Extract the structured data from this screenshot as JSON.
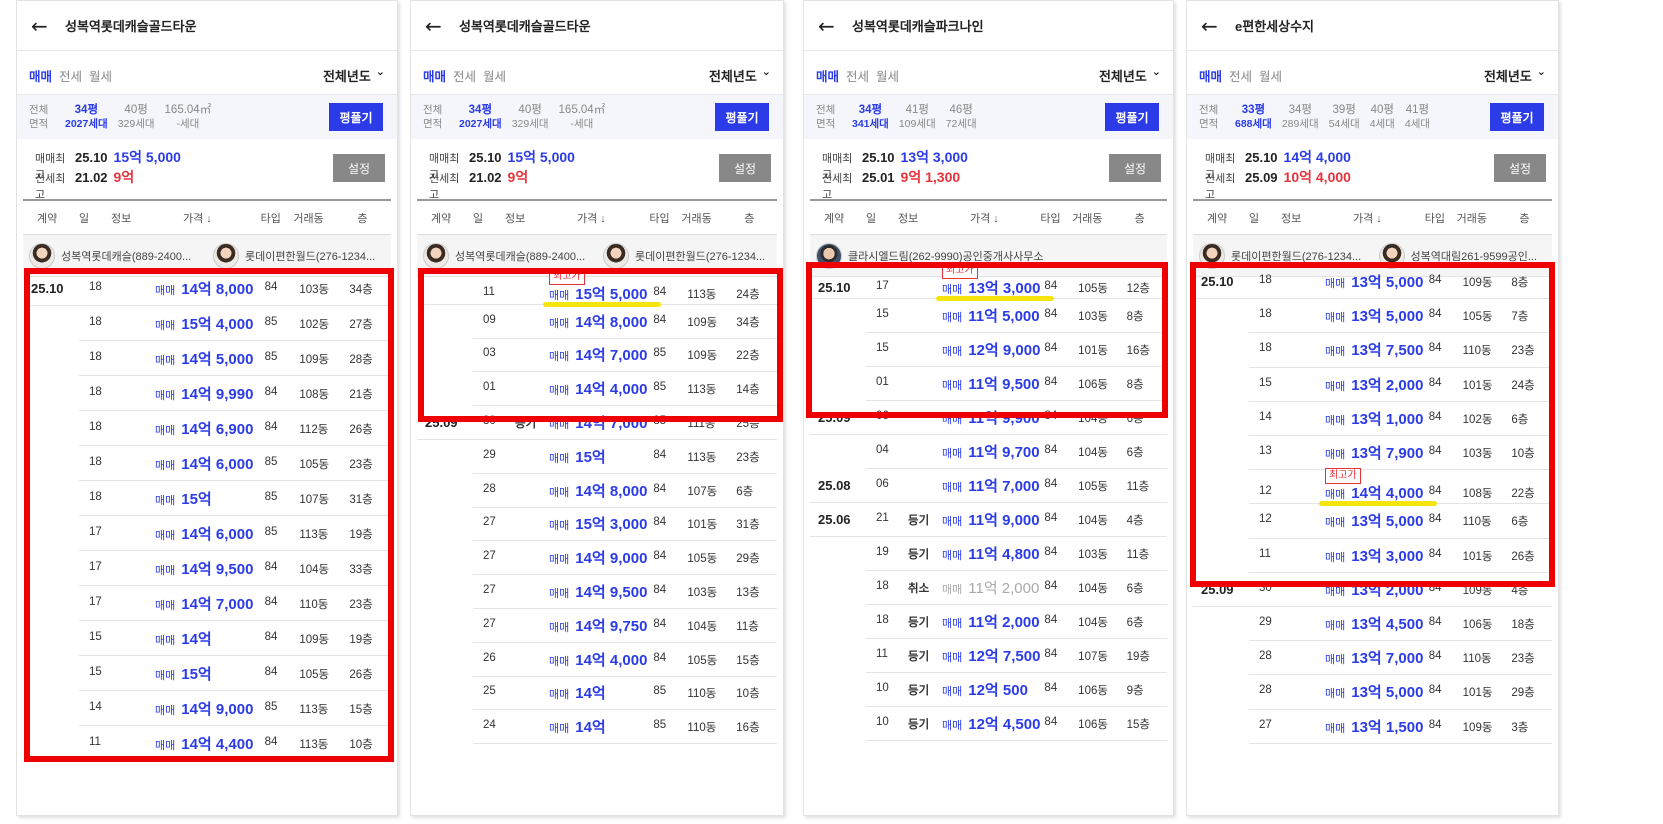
{
  "panels": [
    {
      "title": "성복역롯데캐슬골드타운",
      "tabs": [
        "매매",
        "전세",
        "월세"
      ],
      "year_filter": "전체년도",
      "area": {
        "labels": [
          "전체",
          "면적"
        ],
        "cols": [
          {
            "py": "34평",
            "hh": "2027세대",
            "selected": true
          },
          {
            "py": "40평",
            "hh": "329세대",
            "selected": false
          },
          {
            "py": "165.04㎡",
            "hh": "-세대",
            "selected": false
          }
        ],
        "button": "평풀기"
      },
      "max": {
        "sale_label": "매매최고",
        "sale_date": "25.10",
        "sale_price": "15억 5,000",
        "jeonse_label": "전세최고",
        "jeonse_date": "21.02",
        "jeonse_price": "9억"
      },
      "setting_button": "설정",
      "headers": [
        "계약",
        "일",
        "정보",
        "가격 ↓",
        "타입",
        "거래동",
        "층"
      ],
      "agents": [
        {
          "name": "성복역롯데캐슬(889-2400...",
          "avatar": "female"
        },
        {
          "name": "롯데이편한월드(276-1234...",
          "avatar": "female"
        }
      ],
      "rows": [
        {
          "date": "25.10",
          "day": "18",
          "info": "",
          "trade": "매매",
          "price": "14억 8,000",
          "type": "84",
          "dong": "103동",
          "floor": "34층"
        },
        {
          "date": "",
          "day": "18",
          "info": "",
          "trade": "매매",
          "price": "15억 4,000",
          "type": "85",
          "dong": "102동",
          "floor": "27층"
        },
        {
          "date": "",
          "day": "18",
          "info": "",
          "trade": "매매",
          "price": "14억 5,000",
          "type": "85",
          "dong": "109동",
          "floor": "28층"
        },
        {
          "date": "",
          "day": "18",
          "info": "",
          "trade": "매매",
          "price": "14억 9,990",
          "type": "84",
          "dong": "108동",
          "floor": "21층"
        },
        {
          "date": "",
          "day": "18",
          "info": "",
          "trade": "매매",
          "price": "14억 6,900",
          "type": "84",
          "dong": "112동",
          "floor": "26층"
        },
        {
          "date": "",
          "day": "18",
          "info": "",
          "trade": "매매",
          "price": "14억 6,000",
          "type": "85",
          "dong": "105동",
          "floor": "23층"
        },
        {
          "date": "",
          "day": "18",
          "info": "",
          "trade": "매매",
          "price": "15억",
          "type": "85",
          "dong": "107동",
          "floor": "31층"
        },
        {
          "date": "",
          "day": "17",
          "info": "",
          "trade": "매매",
          "price": "14억 6,000",
          "type": "85",
          "dong": "113동",
          "floor": "19층"
        },
        {
          "date": "",
          "day": "17",
          "info": "",
          "trade": "매매",
          "price": "14억 9,500",
          "type": "84",
          "dong": "104동",
          "floor": "33층"
        },
        {
          "date": "",
          "day": "17",
          "info": "",
          "trade": "매매",
          "price": "14억 7,000",
          "type": "84",
          "dong": "110동",
          "floor": "23층"
        },
        {
          "date": "",
          "day": "15",
          "info": "",
          "trade": "매매",
          "price": "14억",
          "type": "84",
          "dong": "109동",
          "floor": "19층"
        },
        {
          "date": "",
          "day": "15",
          "info": "",
          "trade": "매매",
          "price": "15억",
          "type": "84",
          "dong": "105동",
          "floor": "26층"
        },
        {
          "date": "",
          "day": "14",
          "info": "",
          "trade": "매매",
          "price": "14억 9,000",
          "type": "85",
          "dong": "113동",
          "floor": "15층"
        },
        {
          "date": "",
          "day": "11",
          "info": "",
          "trade": "매매",
          "price": "14억 4,400",
          "type": "84",
          "dong": "113동",
          "floor": "10층"
        }
      ]
    },
    {
      "title": "성복역롯데캐슬골드타운",
      "tabs": [
        "매매",
        "전세",
        "월세"
      ],
      "year_filter": "전체년도",
      "area": {
        "labels": [
          "전체",
          "면적"
        ],
        "cols": [
          {
            "py": "34평",
            "hh": "2027세대",
            "selected": true
          },
          {
            "py": "40평",
            "hh": "329세대",
            "selected": false
          },
          {
            "py": "165.04㎡",
            "hh": "-세대",
            "selected": false
          }
        ],
        "button": "평풀기"
      },
      "max": {
        "sale_label": "매매최고",
        "sale_date": "25.10",
        "sale_price": "15억 5,000",
        "jeonse_label": "전세최고",
        "jeonse_date": "21.02",
        "jeonse_price": "9억"
      },
      "setting_button": "설정",
      "headers": [
        "계약",
        "일",
        "정보",
        "가격 ↓",
        "타입",
        "거래동",
        "층"
      ],
      "agents": [
        {
          "name": "성복역롯데캐슬(889-2400...",
          "avatar": "female"
        },
        {
          "name": "롯데이편한월드(276-1234...",
          "avatar": "female"
        }
      ],
      "rows": [
        {
          "date": "",
          "day": "11",
          "info": "",
          "trade": "매매",
          "price": "15억 5,000",
          "type": "84",
          "dong": "113동",
          "floor": "24층",
          "badge": "최고가",
          "tall": true
        },
        {
          "date": "",
          "day": "09",
          "info": "",
          "trade": "매매",
          "price": "14억 8,000",
          "type": "84",
          "dong": "109동",
          "floor": "34층"
        },
        {
          "date": "",
          "day": "03",
          "info": "",
          "trade": "매매",
          "price": "14억 7,000",
          "type": "85",
          "dong": "109동",
          "floor": "22층"
        },
        {
          "date": "",
          "day": "01",
          "info": "",
          "trade": "매매",
          "price": "14억 4,000",
          "type": "85",
          "dong": "113동",
          "floor": "14층"
        },
        {
          "date": "25.09",
          "day": "30",
          "info": "등기",
          "trade": "매매",
          "price": "14억 7,000",
          "type": "85",
          "dong": "111동",
          "floor": "25층"
        },
        {
          "date": "",
          "day": "29",
          "info": "",
          "trade": "매매",
          "price": "15억",
          "type": "84",
          "dong": "113동",
          "floor": "23층"
        },
        {
          "date": "",
          "day": "28",
          "info": "",
          "trade": "매매",
          "price": "14억 8,000",
          "type": "84",
          "dong": "107동",
          "floor": "6층"
        },
        {
          "date": "",
          "day": "27",
          "info": "",
          "trade": "매매",
          "price": "15억 3,000",
          "type": "84",
          "dong": "101동",
          "floor": "31층"
        },
        {
          "date": "",
          "day": "27",
          "info": "",
          "trade": "매매",
          "price": "14억 9,000",
          "type": "84",
          "dong": "105동",
          "floor": "29층"
        },
        {
          "date": "",
          "day": "27",
          "info": "",
          "trade": "매매",
          "price": "14억 9,500",
          "type": "84",
          "dong": "103동",
          "floor": "13층"
        },
        {
          "date": "",
          "day": "27",
          "info": "",
          "trade": "매매",
          "price": "14억 9,750",
          "type": "84",
          "dong": "104동",
          "floor": "11층"
        },
        {
          "date": "",
          "day": "26",
          "info": "",
          "trade": "매매",
          "price": "14억 4,000",
          "type": "84",
          "dong": "105동",
          "floor": "15층"
        },
        {
          "date": "",
          "day": "25",
          "info": "",
          "trade": "매매",
          "price": "14억",
          "type": "85",
          "dong": "110동",
          "floor": "10층"
        },
        {
          "date": "",
          "day": "24",
          "info": "",
          "trade": "매매",
          "price": "14억",
          "type": "85",
          "dong": "110동",
          "floor": "16층"
        }
      ]
    },
    {
      "title": "성복역롯데캐슬파크나인",
      "tabs": [
        "매매",
        "전세",
        "월세"
      ],
      "year_filter": "전체년도",
      "area": {
        "labels": [
          "전체",
          "면적"
        ],
        "cols": [
          {
            "py": "34평",
            "hh": "341세대",
            "selected": true
          },
          {
            "py": "41평",
            "hh": "109세대",
            "selected": false
          },
          {
            "py": "46평",
            "hh": "72세대",
            "selected": false
          }
        ],
        "button": "평풀기"
      },
      "max": {
        "sale_label": "매매최고",
        "sale_date": "25.10",
        "sale_price": "13억 3,000",
        "jeonse_label": "전세최고",
        "jeonse_date": "25.01",
        "jeonse_price": "9억 1,300"
      },
      "setting_button": "설정",
      "headers": [
        "계약",
        "일",
        "정보",
        "가격 ↓",
        "타입",
        "거래동",
        "층"
      ],
      "agents": [
        {
          "name": "클라시엘드림(262-9990)공인중개사사무소",
          "avatar": "male"
        }
      ],
      "rows": [
        {
          "date": "25.10",
          "day": "17",
          "info": "",
          "trade": "매매",
          "price": "13억 3,000",
          "type": "84",
          "dong": "105동",
          "floor": "12층",
          "badge": "최고가",
          "tall": true
        },
        {
          "date": "",
          "day": "15",
          "info": "",
          "trade": "매매",
          "price": "11억 5,000",
          "type": "84",
          "dong": "103동",
          "floor": "8층"
        },
        {
          "date": "",
          "day": "15",
          "info": "",
          "trade": "매매",
          "price": "12억 9,000",
          "type": "84",
          "dong": "101동",
          "floor": "16층"
        },
        {
          "date": "",
          "day": "01",
          "info": "",
          "trade": "매매",
          "price": "11억 9,500",
          "type": "84",
          "dong": "106동",
          "floor": "8층"
        },
        {
          "date": "25.09",
          "day": "06",
          "info": "",
          "trade": "매매",
          "price": "11억 9,900",
          "type": "84",
          "dong": "104동",
          "floor": "6층"
        },
        {
          "date": "",
          "day": "04",
          "info": "",
          "trade": "매매",
          "price": "11억 9,700",
          "type": "84",
          "dong": "104동",
          "floor": "6층"
        },
        {
          "date": "25.08",
          "day": "06",
          "info": "",
          "trade": "매매",
          "price": "11억 7,000",
          "type": "84",
          "dong": "105동",
          "floor": "11층"
        },
        {
          "date": "25.06",
          "day": "21",
          "info": "등기",
          "trade": "매매",
          "price": "11억 9,000",
          "type": "84",
          "dong": "104동",
          "floor": "4층"
        },
        {
          "date": "",
          "day": "19",
          "info": "등기",
          "trade": "매매",
          "price": "11억 4,800",
          "type": "84",
          "dong": "103동",
          "floor": "11층"
        },
        {
          "date": "",
          "day": "18",
          "info": "취소",
          "trade": "매매",
          "price": "11억 2,000",
          "type": "84",
          "dong": "104동",
          "floor": "6층",
          "cancelled": true
        },
        {
          "date": "",
          "day": "18",
          "info": "등기",
          "trade": "매매",
          "price": "11억 2,000",
          "type": "84",
          "dong": "104동",
          "floor": "6층"
        },
        {
          "date": "",
          "day": "11",
          "info": "등기",
          "trade": "매매",
          "price": "12억 7,500",
          "type": "84",
          "dong": "107동",
          "floor": "19층"
        },
        {
          "date": "",
          "day": "10",
          "info": "등기",
          "trade": "매매",
          "price": "12억 500",
          "type": "84",
          "dong": "106동",
          "floor": "9층"
        },
        {
          "date": "",
          "day": "10",
          "info": "등기",
          "trade": "매매",
          "price": "12억 4,500",
          "type": "84",
          "dong": "106동",
          "floor": "15층"
        }
      ]
    },
    {
      "title": "e편한세상수지",
      "tabs": [
        "매매",
        "전세",
        "월세"
      ],
      "year_filter": "전체년도",
      "area": {
        "labels": [
          "전체",
          "면적"
        ],
        "cols": [
          {
            "py": "33평",
            "hh": "688세대",
            "selected": true
          },
          {
            "py": "34평",
            "hh": "289세대",
            "selected": false
          },
          {
            "py": "39평",
            "hh": "54세대",
            "selected": false
          },
          {
            "py": "40평",
            "hh": "4세대",
            "selected": false
          },
          {
            "py": "41평",
            "hh": "4세대",
            "selected": false
          }
        ],
        "button": "평풀기"
      },
      "max": {
        "sale_label": "매매최고",
        "sale_date": "25.10",
        "sale_price": "14억 4,000",
        "jeonse_label": "전세최고",
        "jeonse_date": "25.09",
        "jeonse_price": "10억 4,000"
      },
      "setting_button": "설정",
      "headers": [
        "계약",
        "일",
        "정보",
        "가격 ↓",
        "타입",
        "거래동",
        "층"
      ],
      "agents": [
        {
          "name": "롯데이편한월드(276-1234...",
          "avatar": "female"
        },
        {
          "name": "성복역대림261-9599공인...",
          "avatar": "female"
        }
      ],
      "rows": [
        {
          "date": "25.10",
          "day": "18",
          "info": "",
          "trade": "매매",
          "price": "13억 5,000",
          "type": "84",
          "dong": "109동",
          "floor": "8층"
        },
        {
          "date": "",
          "day": "18",
          "info": "",
          "trade": "매매",
          "price": "13억 5,000",
          "type": "84",
          "dong": "105동",
          "floor": "7층"
        },
        {
          "date": "",
          "day": "18",
          "info": "",
          "trade": "매매",
          "price": "13억 7,500",
          "type": "84",
          "dong": "110동",
          "floor": "23층"
        },
        {
          "date": "",
          "day": "15",
          "info": "",
          "trade": "매매",
          "price": "13억 2,000",
          "type": "84",
          "dong": "101동",
          "floor": "24층"
        },
        {
          "date": "",
          "day": "14",
          "info": "",
          "trade": "매매",
          "price": "13억 1,000",
          "type": "84",
          "dong": "102동",
          "floor": "6층"
        },
        {
          "date": "",
          "day": "13",
          "info": "",
          "trade": "매매",
          "price": "13억 7,900",
          "type": "84",
          "dong": "103동",
          "floor": "10층"
        },
        {
          "date": "",
          "day": "12",
          "info": "",
          "trade": "매매",
          "price": "14억 4,000",
          "type": "84",
          "dong": "108동",
          "floor": "22층",
          "badge": "최고가",
          "tall": true
        },
        {
          "date": "",
          "day": "12",
          "info": "",
          "trade": "매매",
          "price": "13억 5,000",
          "type": "84",
          "dong": "110동",
          "floor": "6층"
        },
        {
          "date": "",
          "day": "11",
          "info": "",
          "trade": "매매",
          "price": "13억 3,000",
          "type": "84",
          "dong": "101동",
          "floor": "26층"
        },
        {
          "date": "25.09",
          "day": "30",
          "info": "",
          "trade": "매매",
          "price": "13억 2,000",
          "type": "84",
          "dong": "109동",
          "floor": "4층"
        },
        {
          "date": "",
          "day": "29",
          "info": "",
          "trade": "매매",
          "price": "13억 4,500",
          "type": "84",
          "dong": "106동",
          "floor": "18층"
        },
        {
          "date": "",
          "day": "28",
          "info": "",
          "trade": "매매",
          "price": "13억 7,000",
          "type": "84",
          "dong": "110동",
          "floor": "23층"
        },
        {
          "date": "",
          "day": "28",
          "info": "",
          "trade": "매매",
          "price": "13억 5,000",
          "type": "84",
          "dong": "101동",
          "floor": "29층"
        },
        {
          "date": "",
          "day": "27",
          "info": "",
          "trade": "매매",
          "price": "13억 1,500",
          "type": "84",
          "dong": "109동",
          "floor": "3층"
        }
      ]
    }
  ]
}
